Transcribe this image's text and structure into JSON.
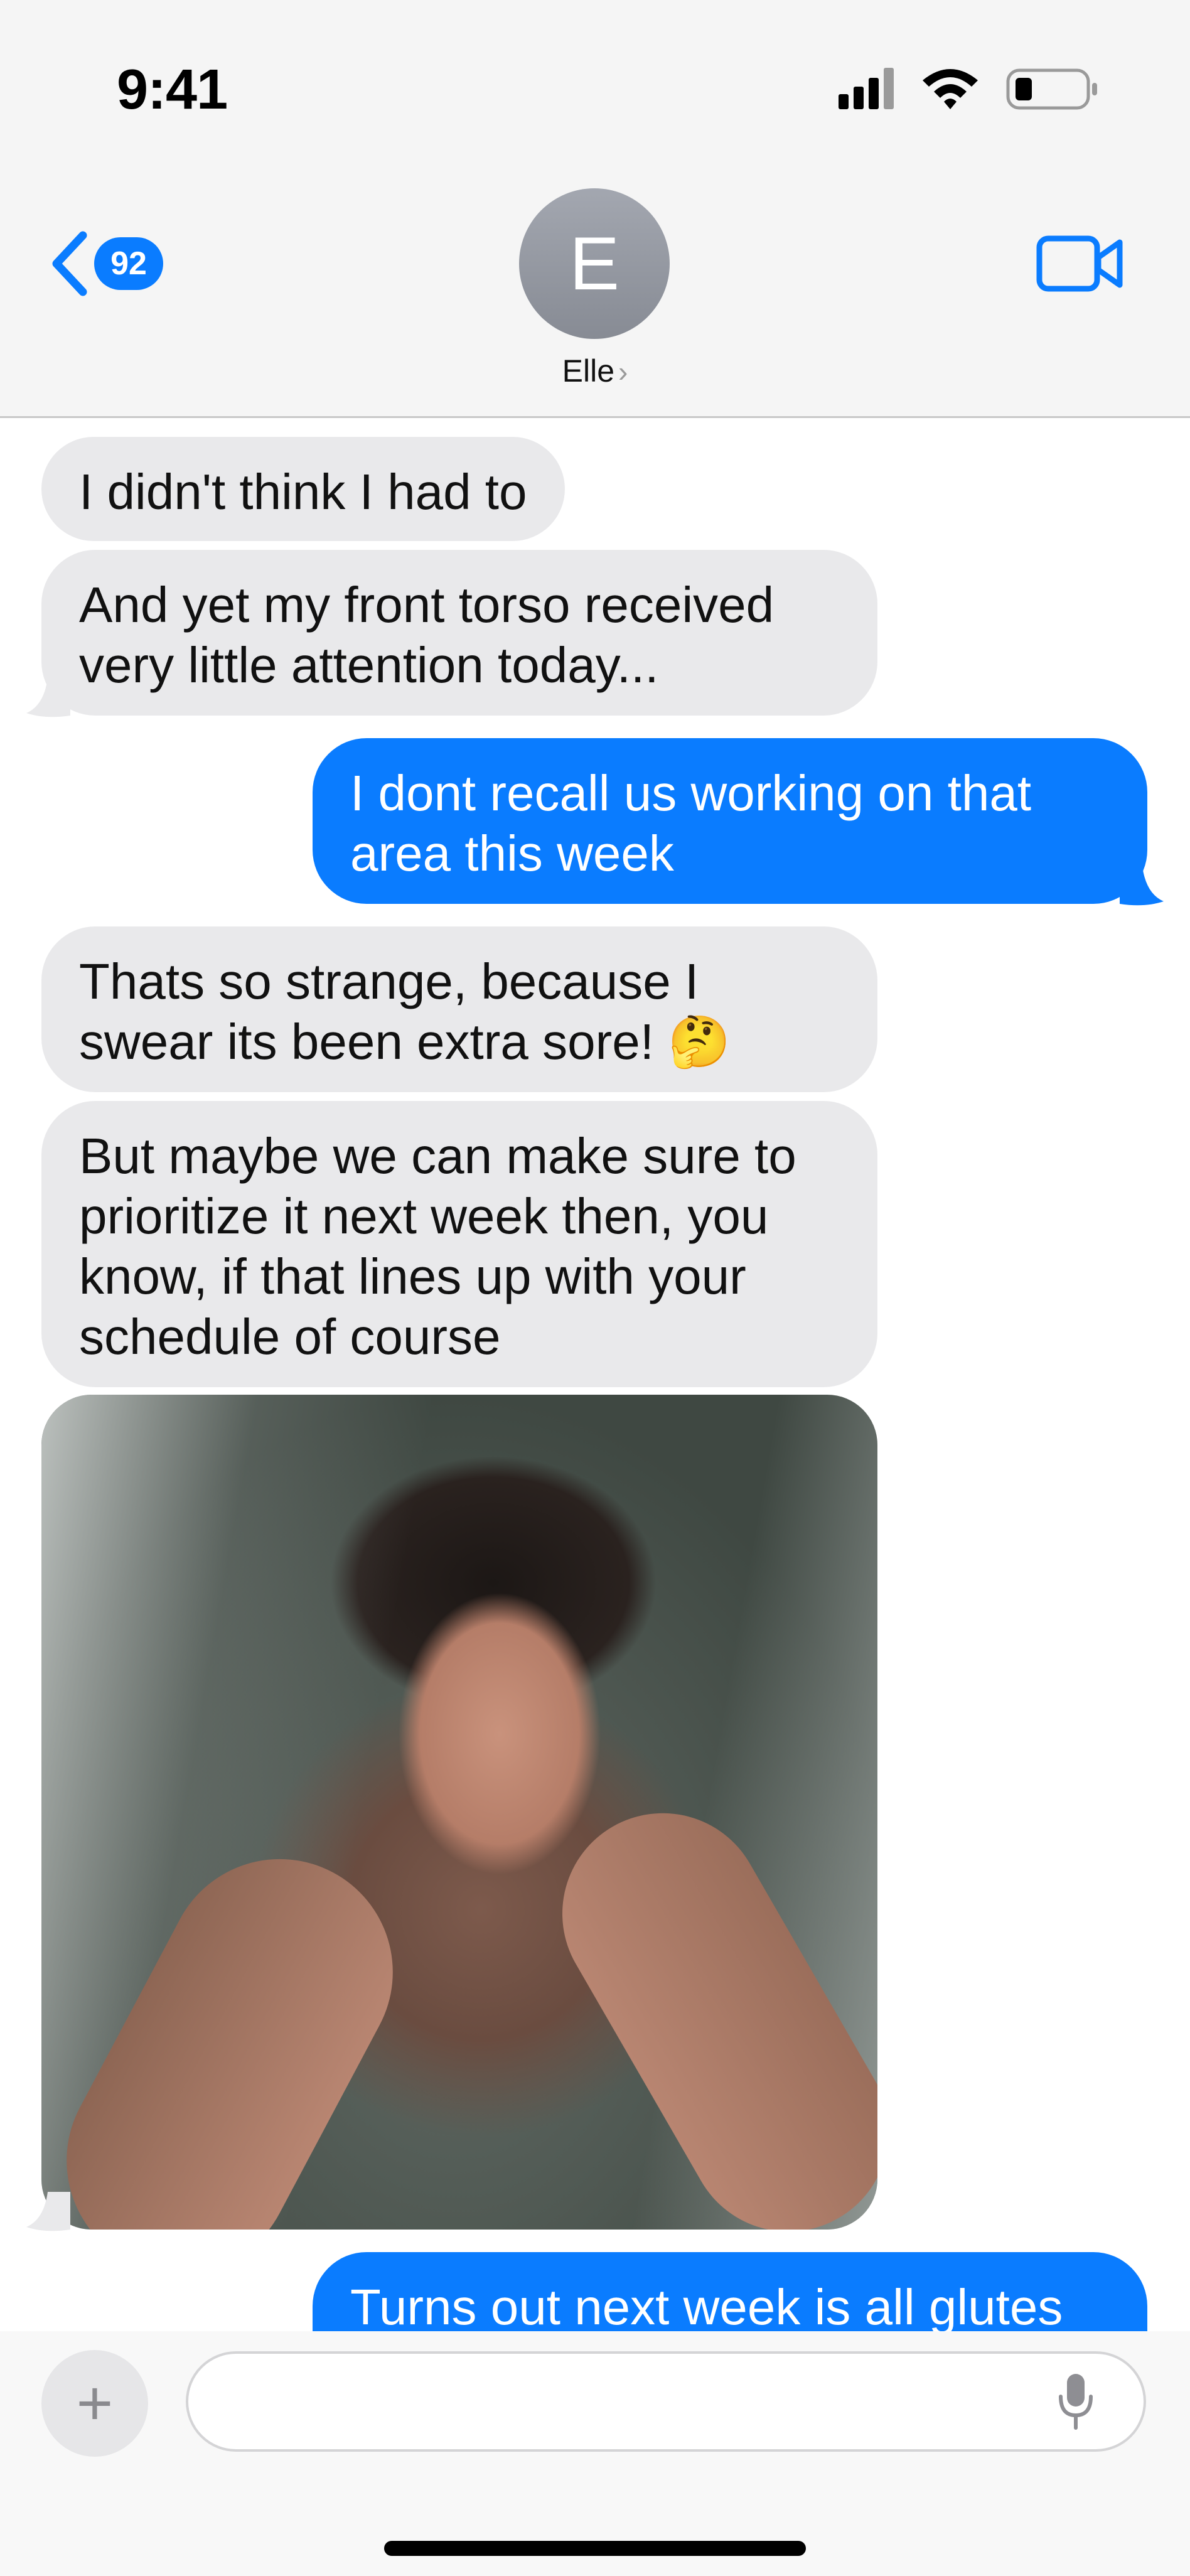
{
  "status_bar": {
    "time": "9:41",
    "icons": [
      "signal-icon",
      "wifi-icon",
      "battery-icon"
    ]
  },
  "header": {
    "back_badge": "92",
    "avatar_initial": "E",
    "contact_name": "Elle",
    "chevron": "›",
    "icons": [
      "back-chevron-icon",
      "video-call-icon"
    ]
  },
  "messages": [
    {
      "direction": "in",
      "text": "I didn't think I had to"
    },
    {
      "direction": "in",
      "text": "And yet my front torso received\nvery little attention today..."
    },
    {
      "direction": "out",
      "text": "I dont recall us working on that\narea this week"
    },
    {
      "direction": "in",
      "text": "Thats so strange, because I\nswear its been extra sore! 🤔"
    },
    {
      "direction": "in",
      "text": "But maybe we can make sure to\nprioritize it next week then, you\nknow, if that lines up with your\nschedule of course"
    },
    {
      "direction": "in",
      "type": "photo"
    },
    {
      "direction": "out",
      "text": "Turns out next week is all glutes"
    }
  ],
  "composer": {
    "plus_label": "+",
    "placeholder": "",
    "icons": [
      "plus-icon",
      "microphone-icon"
    ]
  },
  "colors": {
    "outgoing": "#0a7cff",
    "incoming": "#e9e9eb",
    "header_bg": "#f5f5f5"
  }
}
